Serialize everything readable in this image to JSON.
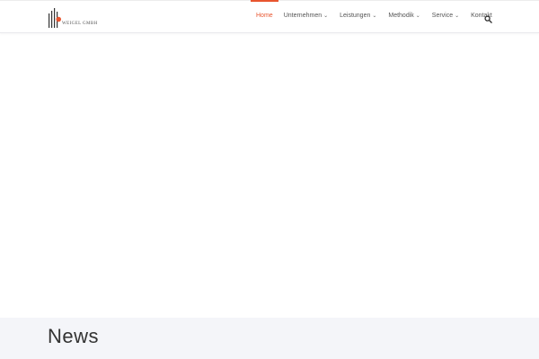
{
  "brand": {
    "name": "WEIGEL GMBH",
    "accent_color": "#e8552f",
    "logo_icon": "weigel-bars-logo"
  },
  "nav": {
    "items": [
      {
        "label": "Home",
        "active": true,
        "has_dropdown": false
      },
      {
        "label": "Unternehmen",
        "active": false,
        "has_dropdown": true
      },
      {
        "label": "Leistungen",
        "active": false,
        "has_dropdown": true
      },
      {
        "label": "Methodik",
        "active": false,
        "has_dropdown": true
      },
      {
        "label": "Service",
        "active": false,
        "has_dropdown": true
      },
      {
        "label": "Kontakt",
        "active": false,
        "has_dropdown": false
      }
    ],
    "dropdown_icon": "chevron-down-icon",
    "search_icon": "search-icon"
  },
  "news": {
    "title": "News",
    "background": "#f4f5f9"
  }
}
